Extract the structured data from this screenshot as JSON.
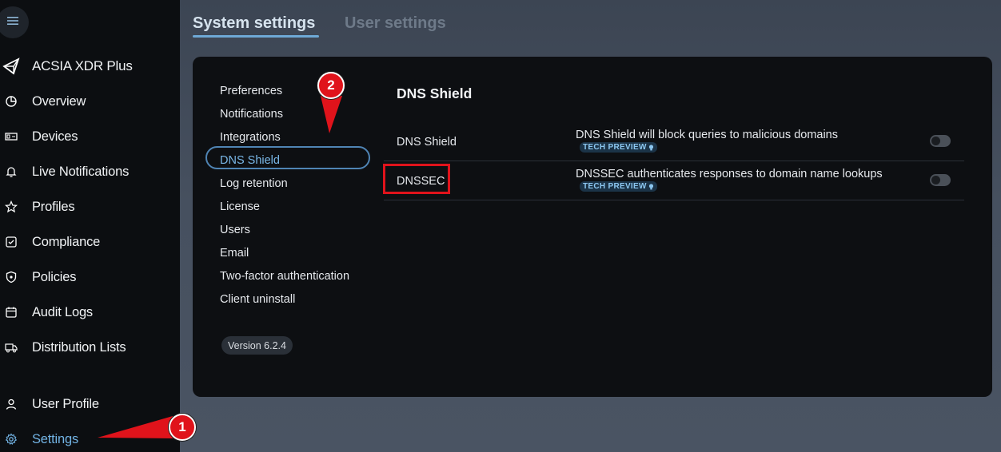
{
  "sidebar": {
    "brand": {
      "label": "ACSIA XDR Plus",
      "icon": "acsia-logo-icon"
    },
    "items": [
      {
        "label": "Overview",
        "icon": "pie-chart-icon"
      },
      {
        "label": "Devices",
        "icon": "devices-icon"
      },
      {
        "label": "Live Notifications",
        "icon": "bell-icon"
      },
      {
        "label": "Profiles",
        "icon": "star-icon"
      },
      {
        "label": "Compliance",
        "icon": "checkbox-icon"
      },
      {
        "label": "Policies",
        "icon": "shield-icon"
      },
      {
        "label": "Audit Logs",
        "icon": "calendar-icon"
      },
      {
        "label": "Distribution Lists",
        "icon": "truck-icon"
      }
    ],
    "bottom": [
      {
        "label": "User Profile",
        "icon": "user-icon"
      },
      {
        "label": "Settings",
        "icon": "gear-icon",
        "active": true
      }
    ]
  },
  "tabs": [
    {
      "label": "System settings",
      "active": true
    },
    {
      "label": "User settings",
      "active": false
    }
  ],
  "submenu": {
    "items": [
      "Preferences",
      "Notifications",
      "Integrations",
      "DNS Shield",
      "Log retention",
      "License",
      "Users",
      "Email",
      "Two-factor authentication",
      "Client uninstall"
    ],
    "active": "DNS Shield",
    "version": "Version 6.2.4"
  },
  "panel": {
    "title": "DNS Shield",
    "rows": [
      {
        "name": "DNS Shield",
        "description": "DNS Shield will block queries to malicious domains",
        "badge": "TECH PREVIEW",
        "enabled": false
      },
      {
        "name": "DNSSEC",
        "description": "DNSSEC authenticates responses to domain name lookups",
        "badge": "TECH PREVIEW",
        "enabled": false
      }
    ]
  },
  "annotations": {
    "step1": "1",
    "step2": "2"
  },
  "colors": {
    "accent": "#72b3e4",
    "callout": "#e0131b",
    "sidebar_bg": "#0c0e11",
    "card_bg": "#0d0f12"
  }
}
